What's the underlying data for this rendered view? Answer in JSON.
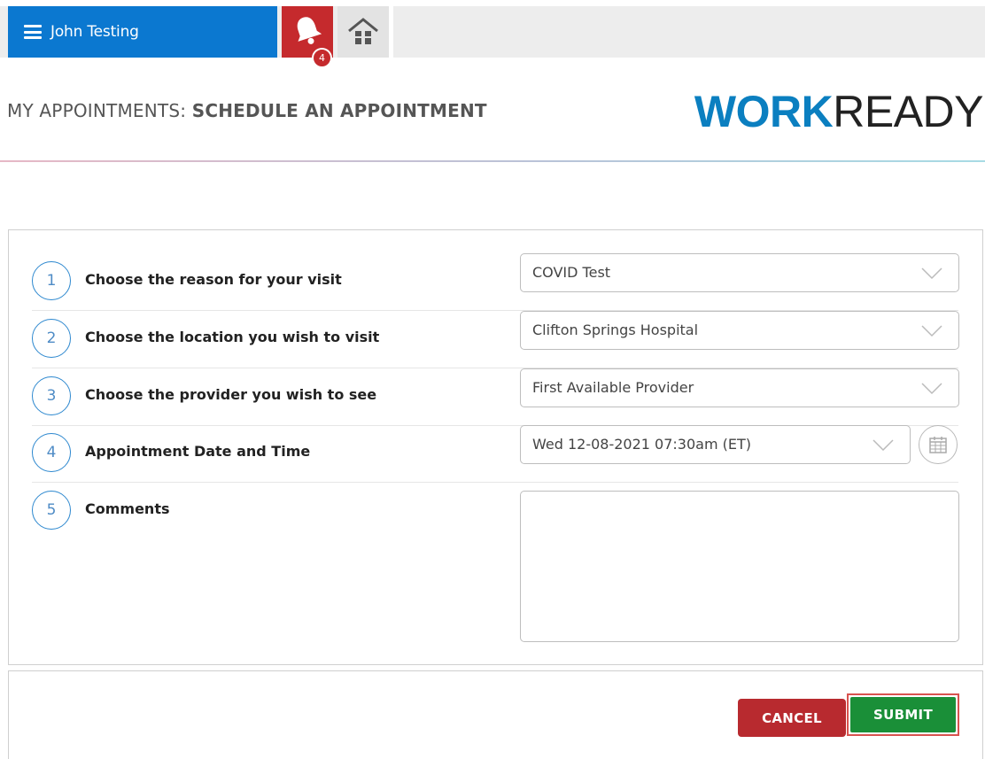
{
  "header": {
    "user_name": "John Testing",
    "notification_count": "4"
  },
  "page": {
    "title_prefix": "MY APPOINTMENTS: ",
    "title_main": "SCHEDULE AN APPOINTMENT",
    "logo_part1": "WORK",
    "logo_part2": "READY"
  },
  "form": {
    "rows": [
      {
        "step": "1",
        "label": "Choose the reason for your visit",
        "value": "COVID Test"
      },
      {
        "step": "2",
        "label": "Choose the location you wish to visit",
        "value": "Clifton Springs Hospital"
      },
      {
        "step": "3",
        "label": "Choose the provider you wish to see",
        "value": "First Available Provider"
      },
      {
        "step": "4",
        "label": "Appointment Date and Time",
        "value": "Wed 12-08-2021 07:30am (ET)"
      },
      {
        "step": "5",
        "label": "Comments",
        "value": ""
      }
    ]
  },
  "actions": {
    "cancel_label": "CANCEL",
    "submit_label": "SUBMIT"
  },
  "colors": {
    "primary_blue": "#0b78d0",
    "alert_red": "#c52a2d",
    "cancel_red": "#b82a2f",
    "submit_green": "#1a8f38",
    "logo_blue": "#0b7fc0"
  }
}
